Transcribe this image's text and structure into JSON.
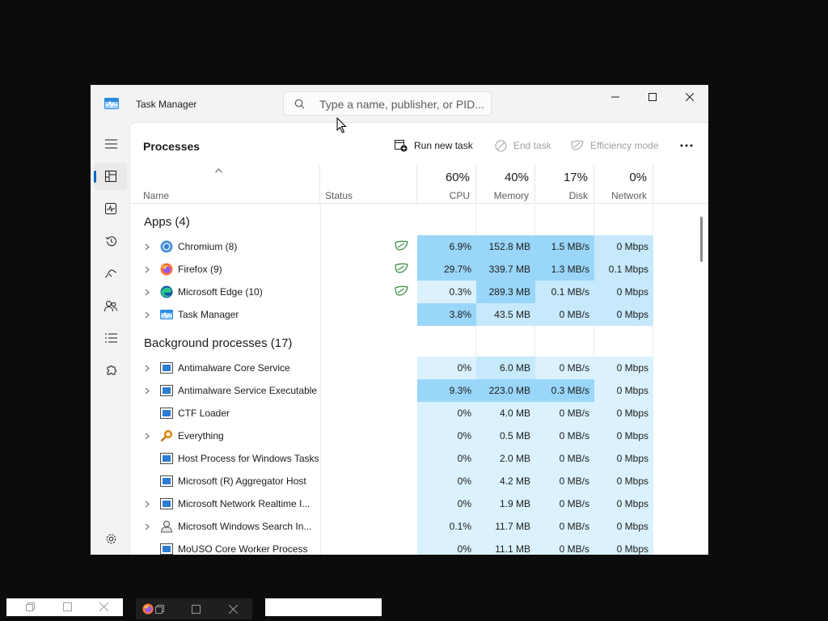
{
  "window": {
    "title": "Task Manager",
    "search_placeholder": "Type a name, publisher, or PID..."
  },
  "toolbar": {
    "page_title": "Processes",
    "run_new_task": "Run new task",
    "end_task": "End task",
    "efficiency_mode": "Efficiency mode"
  },
  "columns": {
    "name": "Name",
    "status": "Status",
    "cpu_pct": "60%",
    "cpu": "CPU",
    "mem_pct": "40%",
    "memory": "Memory",
    "disk_pct": "17%",
    "disk": "Disk",
    "net_pct": "0%",
    "network": "Network"
  },
  "groups": {
    "apps": "Apps (4)",
    "background": "Background processes (17)"
  },
  "apps": [
    {
      "name": "Chromium (8)",
      "cpu": "6.9%",
      "memory": "152.8 MB",
      "disk": "1.5 MB/s",
      "network": "0 Mbps",
      "icon": "chromium-icon",
      "efficiency": true
    },
    {
      "name": "Firefox (9)",
      "cpu": "29.7%",
      "memory": "339.7 MB",
      "disk": "1.3 MB/s",
      "network": "0.1 Mbps",
      "icon": "firefox-icon",
      "efficiency": true
    },
    {
      "name": "Microsoft Edge (10)",
      "cpu": "0.3%",
      "memory": "289.3 MB",
      "disk": "0.1 MB/s",
      "network": "0 Mbps",
      "icon": "edge-icon",
      "efficiency": true
    },
    {
      "name": "Task Manager",
      "cpu": "3.8%",
      "memory": "43.5 MB",
      "disk": "0 MB/s",
      "network": "0 Mbps",
      "icon": "task-manager-icon",
      "efficiency": false
    }
  ],
  "background": [
    {
      "name": "Antimalware Core Service",
      "cpu": "0%",
      "memory": "6.0 MB",
      "disk": "0 MB/s",
      "network": "0 Mbps",
      "expandable": true,
      "icon": "service-icon"
    },
    {
      "name": "Antimalware Service Executable",
      "cpu": "9.3%",
      "memory": "223.0 MB",
      "disk": "0.3 MB/s",
      "network": "0 Mbps",
      "expandable": true,
      "icon": "service-icon"
    },
    {
      "name": "CTF Loader",
      "cpu": "0%",
      "memory": "4.0 MB",
      "disk": "0 MB/s",
      "network": "0 Mbps",
      "expandable": false,
      "icon": "service-icon"
    },
    {
      "name": "Everything",
      "cpu": "0%",
      "memory": "0.5 MB",
      "disk": "0 MB/s",
      "network": "0 Mbps",
      "expandable": true,
      "icon": "everything-icon"
    },
    {
      "name": "Host Process for Windows Tasks",
      "cpu": "0%",
      "memory": "2.0 MB",
      "disk": "0 MB/s",
      "network": "0 Mbps",
      "expandable": false,
      "icon": "service-icon"
    },
    {
      "name": "Microsoft (R) Aggregator Host",
      "cpu": "0%",
      "memory": "4.2 MB",
      "disk": "0 MB/s",
      "network": "0 Mbps",
      "expandable": false,
      "icon": "service-icon"
    },
    {
      "name": "Microsoft Network Realtime I...",
      "cpu": "0%",
      "memory": "1.9 MB",
      "disk": "0 MB/s",
      "network": "0 Mbps",
      "expandable": true,
      "icon": "service-icon"
    },
    {
      "name": "Microsoft Windows Search In...",
      "cpu": "0.1%",
      "memory": "11.7 MB",
      "disk": "0 MB/s",
      "network": "0 Mbps",
      "expandable": true,
      "icon": "search-indexer-icon"
    },
    {
      "name": "MoUSO Core Worker Process",
      "cpu": "0%",
      "memory": "11.1 MB",
      "disk": "0 MB/s",
      "network": "0 Mbps",
      "expandable": false,
      "icon": "service-icon"
    }
  ],
  "colors": {
    "heat_low": "#dbf2fe",
    "heat_mid": "#c6e9fc",
    "heat_high": "#9ad6f9",
    "accent": "#0067c0"
  }
}
